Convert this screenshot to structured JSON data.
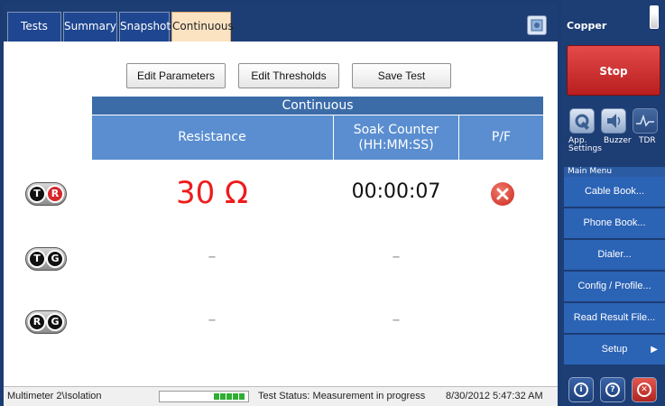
{
  "tabs": [
    {
      "label": "Tests",
      "active": false
    },
    {
      "label": "Summary",
      "active": false
    },
    {
      "label": "Snapshot",
      "active": false
    },
    {
      "label": "Continuous",
      "active": true
    }
  ],
  "toolbar": {
    "edit_parameters": "Edit Parameters",
    "edit_thresholds": "Edit Thresholds",
    "save_test": "Save Test"
  },
  "table": {
    "title": "Continuous",
    "col_resistance": "Resistance",
    "col_soak": "Soak Counter\n(HH:MM:SS)",
    "col_pf": "P/F",
    "rows": [
      {
        "pair": [
          "T",
          "R"
        ],
        "resistance": "30 Ω",
        "soak": "00:00:07",
        "result": "fail"
      },
      {
        "pair": [
          "T",
          "G"
        ],
        "resistance": "–",
        "soak": "–",
        "result": ""
      },
      {
        "pair": [
          "R",
          "G"
        ],
        "resistance": "–",
        "soak": "–",
        "result": ""
      }
    ]
  },
  "status_bar": {
    "path": "Multimeter 2\\Isolation",
    "progress_segments": 5,
    "status": "Test Status: Measurement in progress",
    "datetime": "8/30/2012 5:47:32 AM"
  },
  "right_panel": {
    "title": "Copper",
    "stop": "Stop",
    "quick": [
      {
        "label": "App. Settings",
        "icon": "settings-icon"
      },
      {
        "label": "Buzzer",
        "icon": "speaker-icon"
      },
      {
        "label": "TDR",
        "icon": "waveform-icon"
      }
    ],
    "menu_header": "Main Menu",
    "menu": [
      "Cable Book...",
      "Phone Book...",
      "Dialer...",
      "Config / Profile...",
      "Read Result File...",
      "Setup"
    ],
    "colors": {
      "stop": "#d13232",
      "accent": "#2b63b5",
      "fail": "#cc2a1f"
    }
  }
}
